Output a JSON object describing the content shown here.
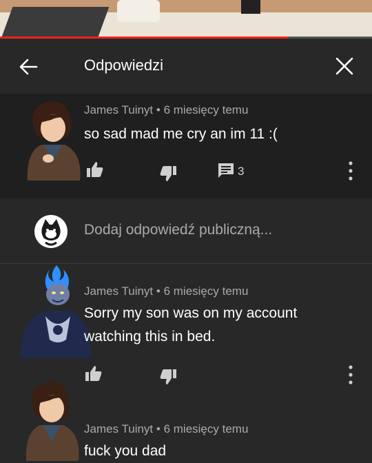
{
  "header": {
    "title": "Odpowiedzi",
    "back_icon": "arrow-back-icon",
    "close_icon": "close-icon"
  },
  "main_comment": {
    "author": "James Tuinyt",
    "time": "6 miesięcy temu",
    "text": "so sad mad me cry an im 11 :(",
    "reply_count": "3"
  },
  "add_reply": {
    "placeholder": "Dodaj odpowiedź publiczną..."
  },
  "replies": [
    {
      "author": "James Tuinyt",
      "time": "6 miesięcy temu",
      "text_line1": "Sorry my son was on my account",
      "text_line2": "watching this in bed."
    },
    {
      "author": "James Tuinyt",
      "time": "6 miesięcy temu",
      "text_line1": "fuck you dad"
    }
  ],
  "colors": {
    "background": "#282828",
    "highlight": "#1f1f1f",
    "secondary_text": "#aaaaaa",
    "progress": "#ff2020"
  }
}
